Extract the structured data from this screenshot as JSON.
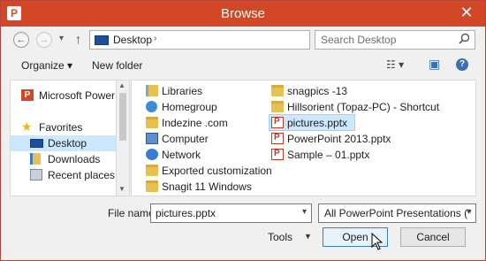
{
  "window": {
    "title": "Browse",
    "app_icon": "P",
    "close_glyph": "✕"
  },
  "nav": {
    "back": "←",
    "forward": "→",
    "recent": "▾",
    "up": "↑",
    "address": "Desktop",
    "address_chev": "›"
  },
  "search": {
    "placeholder": "Search Desktop",
    "icon": "search-icon"
  },
  "toolbar": {
    "organize": "Organize ▾",
    "new_folder": "New folder",
    "view_icon": "☷ ▾",
    "pane_icon": "▣",
    "help_icon": "?"
  },
  "nav_pane": {
    "items": [
      {
        "label": "Microsoft PowerPoint",
        "icon": "P",
        "selected": false
      },
      {
        "label": "Favorites",
        "icon": "★",
        "selected": false
      },
      {
        "label": "Desktop",
        "icon": "desktop-icon",
        "selected": true
      },
      {
        "label": "Downloads",
        "icon": "downloads-icon",
        "selected": false
      },
      {
        "label": "Recent places",
        "icon": "recent-places-icon",
        "selected": false
      }
    ],
    "scroll_up": "▲",
    "scroll_down": "▼"
  },
  "files": {
    "left": [
      {
        "label": "Libraries",
        "icon": "libraries-icon"
      },
      {
        "label": "Homegroup",
        "icon": "homegroup-icon"
      },
      {
        "label": "Indezine .com",
        "icon": "folder-icon"
      },
      {
        "label": "Computer",
        "icon": "computer-icon"
      },
      {
        "label": "Network",
        "icon": "network-icon"
      },
      {
        "label": "Exported customization",
        "icon": "folder-icon"
      },
      {
        "label": "Snagit 11 Windows",
        "icon": "folder-icon"
      }
    ],
    "right": [
      {
        "label": "snagpics -13",
        "icon": "folder-icon"
      },
      {
        "label": "Hillsorient (Topaz-PC) - Shortcut",
        "icon": "folder-icon"
      },
      {
        "label": "pictures.pptx",
        "icon": "pptx-icon",
        "selected": true
      },
      {
        "label": "PowerPoint 2013.pptx",
        "icon": "pptx-icon"
      },
      {
        "label": "Sample – 01.pptx",
        "icon": "pptx-icon"
      }
    ]
  },
  "bottom": {
    "file_name_label": "File name:",
    "file_name_value": "pictures.pptx",
    "file_type": "All PowerPoint Presentations (*",
    "tools": "Tools",
    "tools_chev": "▼",
    "open": "Open",
    "cancel": "Cancel",
    "chev": "▾"
  }
}
